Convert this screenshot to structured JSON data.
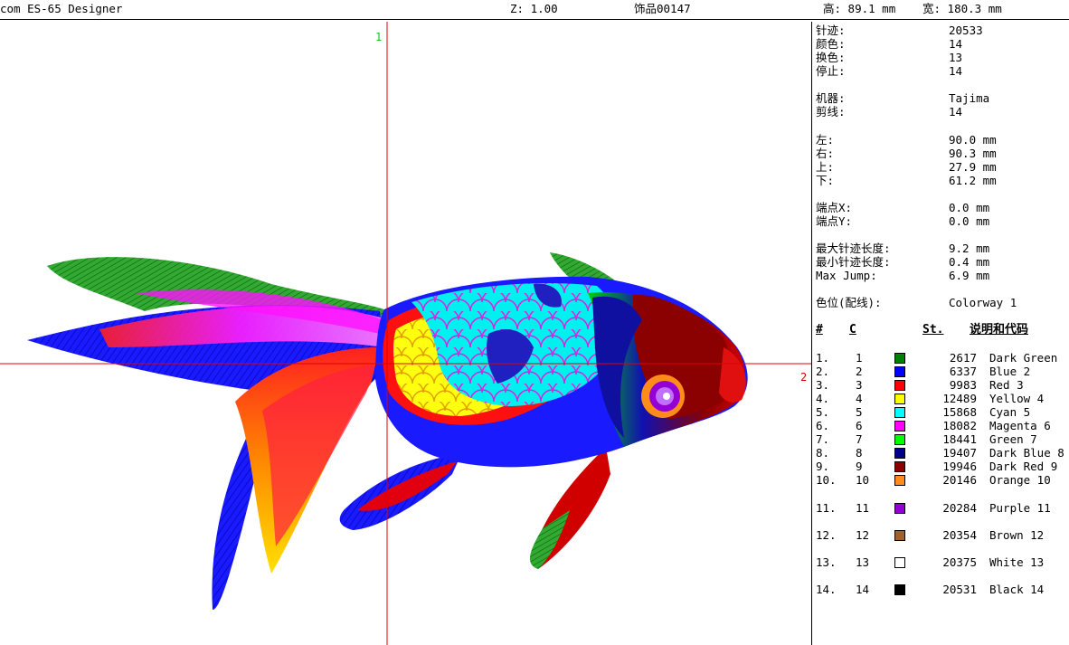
{
  "header": {
    "app_title": "com ES-65 Designer",
    "zoom": "Z: 1.00",
    "design_name": "饰品00147",
    "height": "高: 89.1 mm",
    "width": "宽: 180.3 mm"
  },
  "axes": {
    "label_1": "1",
    "label_2": "2"
  },
  "stats": {
    "stitches_label": "针迹:",
    "stitches": "20533",
    "colors_label": "颜色:",
    "colors": "14",
    "changes_label": "换色:",
    "changes": "13",
    "stops_label": "停止:",
    "stops": "14",
    "machine_label": "机器:",
    "machine": "Tajima",
    "trims_label": "剪线:",
    "trims": "14",
    "left_label": "左:",
    "left": "90.0 mm",
    "right_label": "右:",
    "right": "90.3 mm",
    "top_label": "上:",
    "top": "27.9 mm",
    "bottom_label": "下:",
    "bottom": "61.2 mm",
    "endx_label": "端点X:",
    "endx": "0.0 mm",
    "endy_label": "端点Y:",
    "endy": "0.0 mm",
    "maxlen_label": "最大针迹长度:",
    "maxlen": "9.2 mm",
    "minlen_label": "最小针迹长度:",
    "minlen": "0.4 mm",
    "maxjump_label": "Max Jump:",
    "maxjump": "6.9 mm",
    "colorway_label": "色位(配线):",
    "colorway": "Colorway 1"
  },
  "table": {
    "headers": {
      "index": "#",
      "color": "C",
      "stitch": "St.",
      "desc": "说明和代码"
    },
    "rows": [
      {
        "idx": "1.",
        "c": "1",
        "st": "2617",
        "name": "Dark Green",
        "hex": "#008000"
      },
      {
        "idx": "2.",
        "c": "2",
        "st": "6337",
        "name": "Blue 2",
        "hex": "#0000ff"
      },
      {
        "idx": "3.",
        "c": "3",
        "st": "9983",
        "name": "Red 3",
        "hex": "#ff0000"
      },
      {
        "idx": "4.",
        "c": "4",
        "st": "12489",
        "name": "Yellow 4",
        "hex": "#ffff00"
      },
      {
        "idx": "5.",
        "c": "5",
        "st": "15868",
        "name": "Cyan 5",
        "hex": "#00ffff"
      },
      {
        "idx": "6.",
        "c": "6",
        "st": "18082",
        "name": "Magenta 6",
        "hex": "#ff00ff"
      },
      {
        "idx": "7.",
        "c": "7",
        "st": "18441",
        "name": "Green 7",
        "hex": "#00ff00"
      },
      {
        "idx": "8.",
        "c": "8",
        "st": "19407",
        "name": "Dark Blue 8",
        "hex": "#00008b"
      },
      {
        "idx": "9.",
        "c": "9",
        "st": "19946",
        "name": "Dark Red 9",
        "hex": "#8b0000"
      },
      {
        "idx": "10.",
        "c": "10",
        "st": "20146",
        "name": "Orange 10",
        "hex": "#ff8c1a"
      },
      {
        "idx": "11.",
        "c": "11",
        "st": "20284",
        "name": "Purple 11",
        "hex": "#9400d3"
      },
      {
        "idx": "12.",
        "c": "12",
        "st": "20354",
        "name": "Brown 12",
        "hex": "#a0602a"
      },
      {
        "idx": "13.",
        "c": "13",
        "st": "20375",
        "name": "White 13",
        "hex": "#ffffff"
      },
      {
        "idx": "14.",
        "c": "14",
        "st": "20531",
        "name": "Black 14",
        "hex": "#000000"
      }
    ]
  }
}
